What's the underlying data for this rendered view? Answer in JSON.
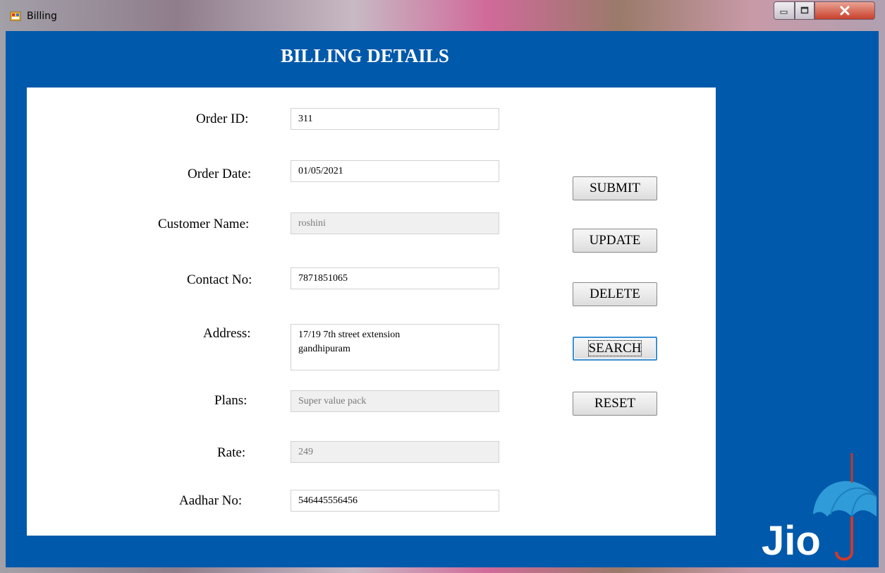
{
  "window": {
    "title": "Billing"
  },
  "header": {
    "title": "BILLING DETAILS"
  },
  "form": {
    "order_id_label": "Order ID:",
    "order_id_value": "311",
    "order_date_label": "Order Date:",
    "order_date_value": "01/05/2021",
    "customer_name_label": "Customer Name:",
    "customer_name_value": "roshini",
    "contact_label": "Contact No:",
    "contact_value": "7871851065",
    "address_label": "Address:",
    "address_value": "17/19 7th street extension\ngandhipuram",
    "plans_label": "Plans:",
    "plans_value": "Super value pack",
    "rate_label": "Rate:",
    "rate_value": "249",
    "aadhar_label": "Aadhar No:",
    "aadhar_value": "546445556456"
  },
  "actions": {
    "submit": "SUBMIT",
    "update": "UPDATE",
    "delete": "DELETE",
    "search": "SEARCH",
    "reset": "RESET"
  },
  "logo": {
    "text": "Jio",
    "icon": "umbrella-icon",
    "color": "#2a9ad8"
  },
  "colors": {
    "background": "#0059aa",
    "panel": "#ffffff"
  }
}
